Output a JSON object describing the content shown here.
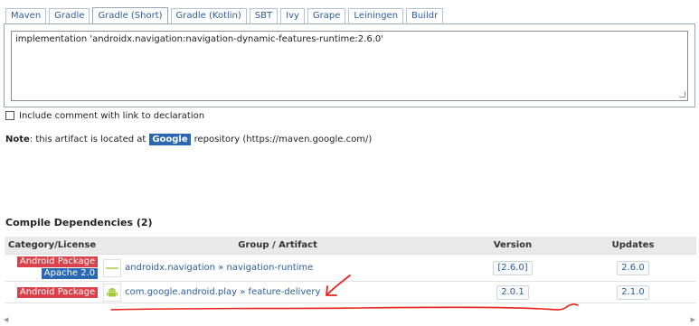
{
  "tabs": [
    {
      "label": "Maven"
    },
    {
      "label": "Gradle"
    },
    {
      "label": "Gradle (Short)",
      "active": true
    },
    {
      "label": "Gradle (Kotlin)"
    },
    {
      "label": "SBT"
    },
    {
      "label": "Ivy"
    },
    {
      "label": "Grape"
    },
    {
      "label": "Leiningen"
    },
    {
      "label": "Buildr"
    }
  ],
  "snippet": {
    "value": "implementation 'androidx.navigation:navigation-dynamic-features-runtime:2.6.0'"
  },
  "include_comment": {
    "label": "Include comment with link to declaration",
    "checked": false
  },
  "note": {
    "prefix": "Note",
    "text_before": ": this artifact is located at",
    "badge": "Google",
    "text_after": "repository (https://maven.google.com/)"
  },
  "compile_deps": {
    "title": "Compile Dependencies (2)",
    "headers": {
      "category": "Category/License",
      "group_artifact": "Group / Artifact",
      "version": "Version",
      "updates": "Updates"
    },
    "rows": [
      {
        "category": "Android Package",
        "license": "Apache 2.0",
        "icon": "androidx-logo-icon",
        "group": "androidx.navigation",
        "separator": "»",
        "artifact": "navigation-runtime",
        "version": "[2.6.0]",
        "update": "2.6.0"
      },
      {
        "category": "Android Package",
        "icon": "android-robot-icon",
        "group": "com.google.android.play",
        "separator": "»",
        "artifact": "feature-delivery",
        "version": "2.0.1",
        "update": "2.1.0"
      }
    ]
  },
  "colors": {
    "link": "#2a5d9f",
    "category_badge": "#d9424a",
    "license_badge": "#2a68b3",
    "google_badge": "#2a68b3",
    "annotation": "#e8221b",
    "android_green": "#a4c639"
  },
  "annotation": {
    "type": "red hand-drawn arrow and underline",
    "target": "com.google.android.play » feature-delivery"
  }
}
